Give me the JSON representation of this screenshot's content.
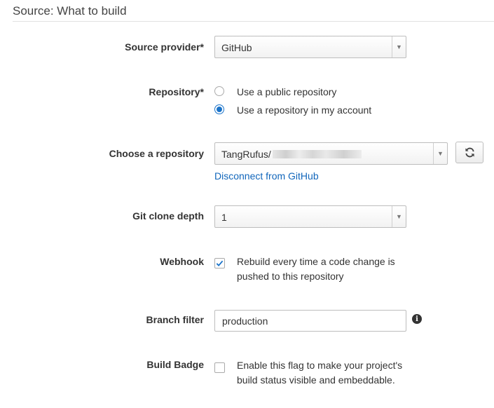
{
  "section": {
    "title": "Source: What to build"
  },
  "source_provider": {
    "label": "Source provider*",
    "value": "GitHub"
  },
  "repository": {
    "label": "Repository*",
    "options": [
      {
        "label": "Use a public repository",
        "selected": false
      },
      {
        "label": "Use a repository in my account",
        "selected": true
      }
    ]
  },
  "choose_repository": {
    "label": "Choose a repository",
    "value": "TangRufus/",
    "disconnect_link": "Disconnect from GitHub",
    "refresh_icon": "refresh-icon"
  },
  "git_clone_depth": {
    "label": "Git clone depth",
    "value": "1"
  },
  "webhook": {
    "label": "Webhook",
    "checked": true,
    "description": "Rebuild every time a code change is pushed to this repository"
  },
  "branch_filter": {
    "label": "Branch filter",
    "value": "production",
    "info_icon": "info-icon"
  },
  "build_badge": {
    "label": "Build Badge",
    "checked": false,
    "description": "Enable this flag to make your project's build status visible and embeddable."
  },
  "colors": {
    "accent": "#1a73c9",
    "link": "#1166bb"
  }
}
